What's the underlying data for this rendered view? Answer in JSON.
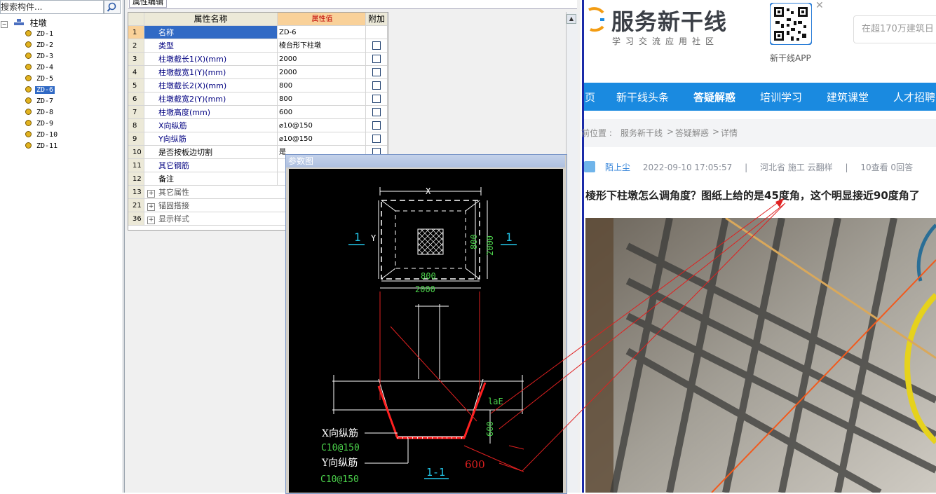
{
  "left_panel": {
    "search_placeholder": "搜索构件...",
    "tree_root": "柱墩",
    "items": [
      "ZD-1",
      "ZD-2",
      "ZD-3",
      "ZD-4",
      "ZD-5",
      "ZD-6",
      "ZD-7",
      "ZD-8",
      "ZD-9",
      "ZD-10",
      "ZD-11"
    ],
    "selected_item": "ZD-6"
  },
  "property_panel": {
    "tab_label": "属性编辑",
    "headers": {
      "name": "属性名称",
      "value": "属性值",
      "extra": "附加"
    },
    "rows": [
      {
        "num": "1",
        "name": "名称",
        "value": "ZD-6"
      },
      {
        "num": "2",
        "name": "类型",
        "value": "棱台形下柱墩"
      },
      {
        "num": "3",
        "name": "柱墩截长1(X)(mm)",
        "value": "2000"
      },
      {
        "num": "4",
        "name": "柱墩截宽1(Y)(mm)",
        "value": "2000"
      },
      {
        "num": "5",
        "name": "柱墩截长2(X)(mm)",
        "value": "800"
      },
      {
        "num": "6",
        "name": "柱墩截宽2(Y)(mm)",
        "value": "800"
      },
      {
        "num": "7",
        "name": "柱墩高度(mm)",
        "value": "600"
      },
      {
        "num": "8",
        "name": "X向纵筋",
        "value": "⌀10@150"
      },
      {
        "num": "9",
        "name": "Y向纵筋",
        "value": "⌀10@150"
      },
      {
        "num": "10",
        "name": "是否按板边切割",
        "value": "是"
      },
      {
        "num": "11",
        "name": "其它钢筋",
        "value": ""
      },
      {
        "num": "12",
        "name": "备注",
        "value": ""
      },
      {
        "num": "13",
        "name": "其它属性",
        "value": ""
      },
      {
        "num": "21",
        "name": "锚固搭接",
        "value": ""
      },
      {
        "num": "36",
        "name": "显示样式",
        "value": ""
      }
    ]
  },
  "param_window": {
    "title": "参数图",
    "labels": {
      "dim_x": "X",
      "dim_y": "Y",
      "section_mark": "1",
      "dim_800": "800",
      "dim_2000": "2000",
      "lae": "laE",
      "dim_600": "600",
      "x_rebar_label": "X向纵筋",
      "x_rebar_spec": "C10@150",
      "y_rebar_label": "Y向纵筋",
      "y_rebar_spec": "C10@150",
      "section_name": "1-1",
      "annot_600": "600"
    }
  },
  "web": {
    "logo_text": "服务新干线",
    "logo_sub": "学习交流应用社区",
    "qr_caption": "新干线APP",
    "search_placeholder": "在超170万建筑日",
    "nav": [
      "页",
      "新干线头条",
      "答疑解惑",
      "培训学习",
      "建筑课堂",
      "人才招聘"
    ],
    "nav_active": "答疑解惑",
    "breadcrumb": [
      "前位置 :",
      "服务新干线",
      ">",
      "答疑解惑",
      ">",
      "详情"
    ],
    "meta": {
      "user": "陌上尘",
      "time": "2022-09-10 17:05:57",
      "sep": "|",
      "location": "河北省  施工  云翻样",
      "sep2": "|",
      "stats": "10查看   0回答"
    },
    "post_title": "棱形下柱墩怎么调角度？图纸上给的是45度角，这个明显接近90度角了",
    "colors": {
      "nav_bg": "#1a8ae0",
      "accent": "#f39c12",
      "annotation_red": "#e02020"
    }
  }
}
